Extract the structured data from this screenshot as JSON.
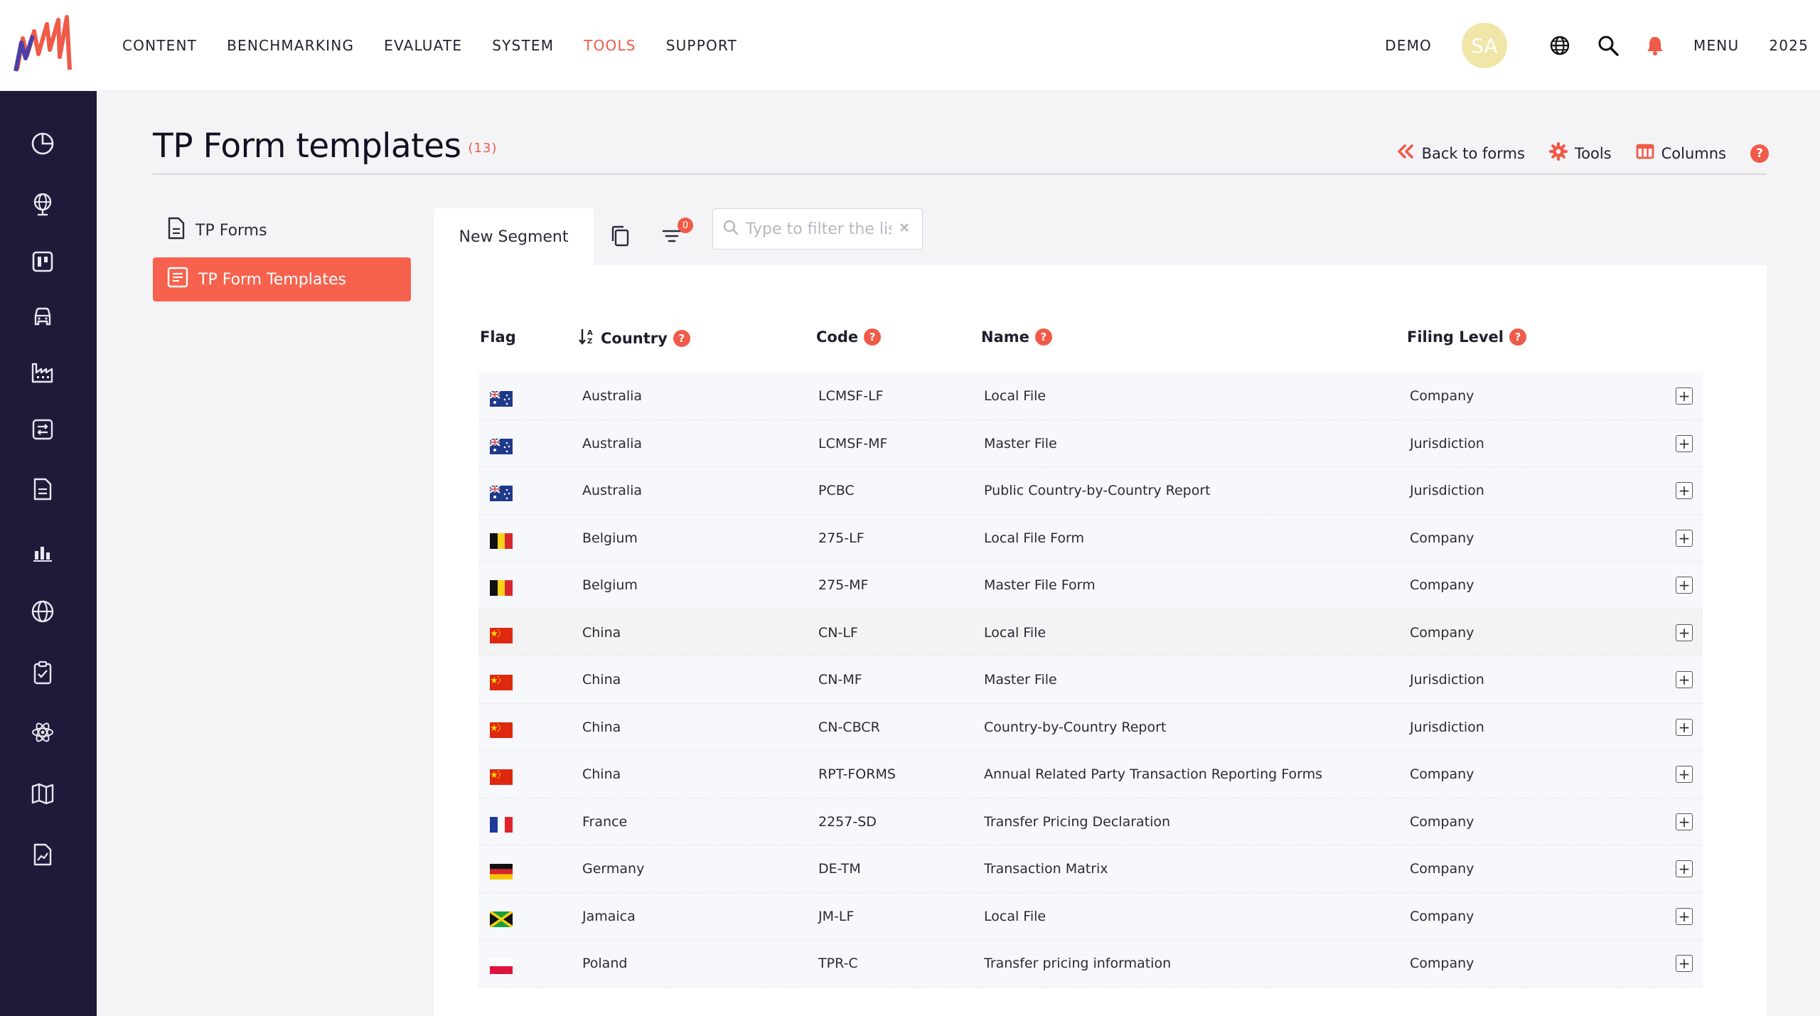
{
  "topnav": {
    "items": [
      {
        "label": "CONTENT"
      },
      {
        "label": "BENCHMARKING"
      },
      {
        "label": "EVALUATE"
      },
      {
        "label": "SYSTEM"
      },
      {
        "label": "TOOLS",
        "active": true
      },
      {
        "label": "SUPPORT"
      }
    ],
    "demo_label": "DEMO",
    "avatar_initials": "SA",
    "menu_label": "MENU",
    "year_label": "2025"
  },
  "sidebar": {
    "icons": [
      "pie-chart-icon",
      "globe-tree-icon",
      "board-icon",
      "car-icon",
      "factory-icon",
      "transfer-icon",
      "document-icon",
      "bar-chart-icon",
      "globe-icon",
      "clipboard-check-icon",
      "atom-icon",
      "map-icon",
      "report-icon"
    ]
  },
  "page": {
    "title": "TP Form templates",
    "count": "(13)",
    "actions": {
      "back": "Back to forms",
      "tools": "Tools",
      "columns": "Columns"
    }
  },
  "leftnav": {
    "items": [
      {
        "label": "TP Forms"
      },
      {
        "label": "TP Form Templates",
        "active": true
      }
    ]
  },
  "toolbar": {
    "segment_label": "New Segment",
    "filter_count": "0",
    "search_placeholder": "Type to filter the list"
  },
  "table": {
    "headers": {
      "flag": "Flag",
      "country": "Country",
      "code": "Code",
      "name": "Name",
      "filing_level": "Filing Level"
    },
    "rows": [
      {
        "flag": "au",
        "country": "Australia",
        "code": "LCMSF-LF",
        "name": "Local File",
        "level": "Company"
      },
      {
        "flag": "au",
        "country": "Australia",
        "code": "LCMSF-MF",
        "name": "Master File",
        "level": "Jurisdiction"
      },
      {
        "flag": "au",
        "country": "Australia",
        "code": "PCBC",
        "name": "Public Country-by-Country Report",
        "level": "Jurisdiction"
      },
      {
        "flag": "be",
        "country": "Belgium",
        "code": "275-LF",
        "name": "Local File Form",
        "level": "Company"
      },
      {
        "flag": "be",
        "country": "Belgium",
        "code": "275-MF",
        "name": "Master File Form",
        "level": "Company"
      },
      {
        "flag": "cn",
        "country": "China",
        "code": "CN-LF",
        "name": "Local File",
        "level": "Company"
      },
      {
        "flag": "cn",
        "country": "China",
        "code": "CN-MF",
        "name": "Master File",
        "level": "Jurisdiction"
      },
      {
        "flag": "cn",
        "country": "China",
        "code": "CN-CBCR",
        "name": "Country-by-Country Report",
        "level": "Jurisdiction"
      },
      {
        "flag": "cn",
        "country": "China",
        "code": "RPT-FORMS",
        "name": "Annual Related Party Transaction Reporting Forms",
        "level": "Company"
      },
      {
        "flag": "fr",
        "country": "France",
        "code": "2257-SD",
        "name": "Transfer Pricing Declaration",
        "level": "Company"
      },
      {
        "flag": "de",
        "country": "Germany",
        "code": "DE-TM",
        "name": "Transaction Matrix",
        "level": "Company"
      },
      {
        "flag": "jm",
        "country": "Jamaica",
        "code": "JM-LF",
        "name": "Local File",
        "level": "Company"
      },
      {
        "flag": "pl",
        "country": "Poland",
        "code": "TPR-C",
        "name": "Transfer pricing information",
        "level": "Company"
      }
    ]
  },
  "colors": {
    "accent": "#f05a48",
    "sidebar": "#1e1b3a",
    "active_item": "#f6624d"
  }
}
